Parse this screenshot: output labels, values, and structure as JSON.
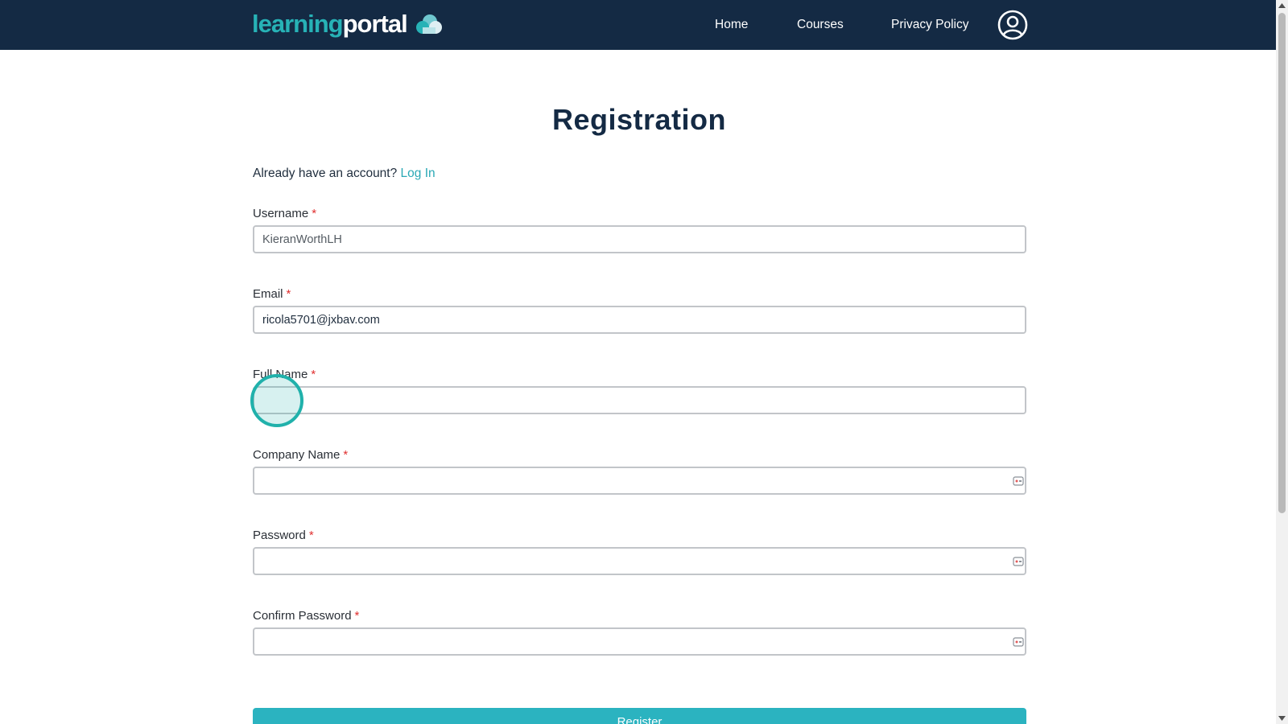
{
  "header": {
    "logo_part1": "learning",
    "logo_part2": "portal",
    "nav": {
      "home": "Home",
      "courses": "Courses",
      "privacy": "Privacy Policy"
    },
    "avatar_icon": "user-circle-icon"
  },
  "page": {
    "title": "Registration",
    "account_prompt": "Already have an account?",
    "login_link": "Log In"
  },
  "form": {
    "required_marker": "*",
    "username": {
      "label": "Username",
      "value": "KieranWorthLH"
    },
    "email": {
      "label": "Email",
      "value": "ricola5701@jxbav.com"
    },
    "full_name": {
      "label": "Full Name",
      "value": ""
    },
    "company_name": {
      "label": "Company Name",
      "value": ""
    },
    "password": {
      "label": "Password",
      "value": ""
    },
    "confirm_password": {
      "label": "Confirm Password",
      "value": ""
    },
    "submit_label": "Register"
  },
  "colors": {
    "header_bg": "#142a44",
    "accent": "#2bb3c0",
    "required": "#e03030"
  }
}
